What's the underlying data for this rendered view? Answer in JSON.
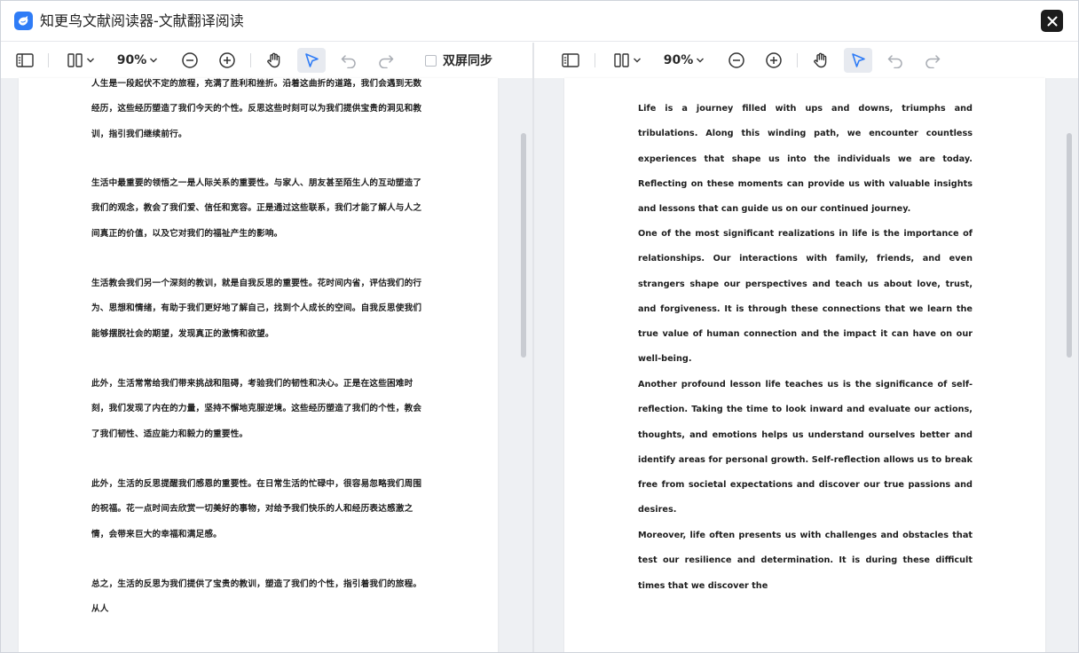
{
  "window": {
    "title": "知更鸟文献阅读器-文献翻译阅读"
  },
  "toolbar_left": {
    "zoom": "90%",
    "sync_label": "双屏同步"
  },
  "toolbar_right": {
    "zoom": "90%"
  },
  "source_doc": {
    "paragraphs": [
      "人生是一段起伏不定的旅程，充满了胜利和挫折。沿着这曲折的道路，我们会遇到无数经历，这些经历塑造了我们今天的个性。反思这些时刻可以为我们提供宝贵的洞见和教训，指引我们继续前行。",
      "生活中最重要的领悟之一是人际关系的重要性。与家人、朋友甚至陌生人的互动塑造了我们的观念，教会了我们爱、信任和宽容。正是通过这些联系，我们才能了解人与人之间真正的价值，以及它对我们的福祉产生的影响。",
      "生活教会我们另一个深刻的教训，就是自我反思的重要性。花时间内省，评估我们的行为、思想和情绪，有助于我们更好地了解自己，找到个人成长的空间。自我反思使我们能够摆脱社会的期望，发现真正的激情和欲望。",
      "此外，生活常常给我们带来挑战和阻碍，考验我们的韧性和决心。正是在这些困难时刻，我们发现了内在的力量，坚持不懈地克服逆境。这些经历塑造了我们的个性，教会了我们韧性、适应能力和毅力的重要性。",
      "此外，生活的反思提醒我们感恩的重要性。在日常生活的忙碌中，很容易忽略我们周围的祝福。花一点时间去欣赏一切美好的事物，对给予我们快乐的人和经历表达感激之情，会带来巨大的幸福和满足感。",
      "总之，生活的反思为我们提供了宝贵的教训，塑造了我们的个性，指引着我们的旅程。从人"
    ]
  },
  "translated_doc": {
    "paragraphs": [
      "Life is a journey filled with ups and downs, triumphs and tribulations. Along this winding path, we encounter countless experiences that shape us into the individuals we are today. Reflecting on these moments can provide us with valuable insights and lessons that can guide us on our continued journey.",
      "One of the most significant realizations in life is the importance of relationships. Our interactions with family, friends, and even strangers shape our perspectives and teach us about love, trust, and forgiveness. It is through these connections that we learn the true value of human connection and the impact it can have on our well-being.",
      "Another profound lesson life teaches us is the significance of self-reflection. Taking the time to look inward and evaluate our actions, thoughts, and emotions helps us understand ourselves better and identify areas for personal growth. Self-reflection allows us to break free from societal expectations and discover our true passions and desires.",
      "Moreover, life often presents us with challenges and obstacles that test our resilience and determination. It is during these difficult times that we discover the"
    ]
  },
  "icons": {
    "app": "app-bird-icon",
    "close": "close-icon",
    "sidebar": "sidebar-toggle-icon",
    "layout": "page-layout-icon",
    "zoom_out": "zoom-out-icon",
    "zoom_in": "zoom-in-icon",
    "hand": "hand-tool-icon",
    "select": "select-pointer-icon",
    "undo": "undo-icon",
    "redo": "redo-icon"
  },
  "colors": {
    "accent": "#2f7cf6",
    "close_bg": "#1c1c1c",
    "select_active_bg": "#e7eaf0"
  }
}
